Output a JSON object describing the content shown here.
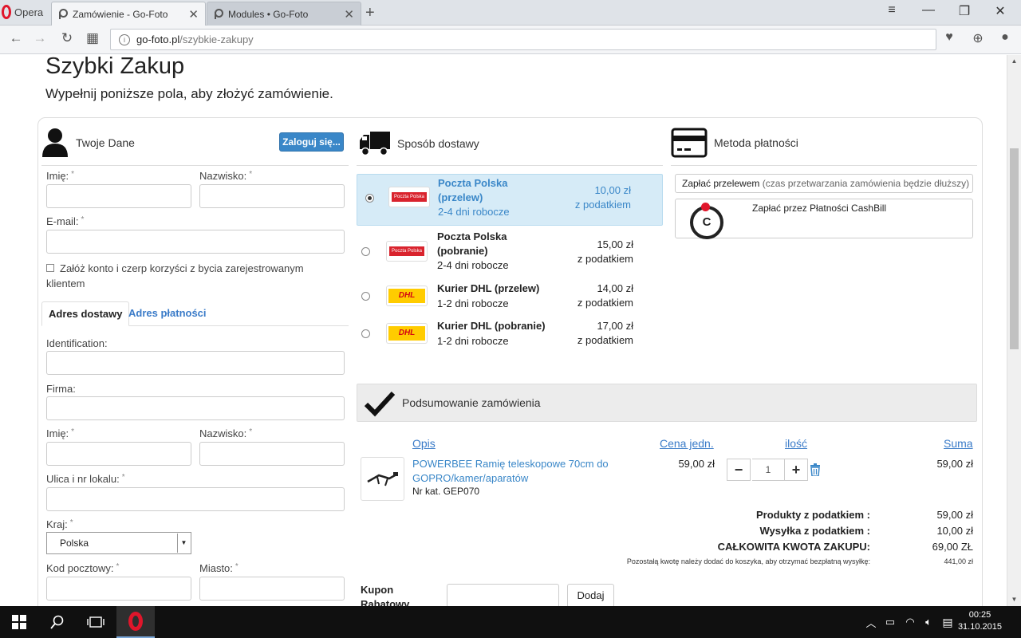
{
  "browser": {
    "menu_label": "Opera",
    "tabs": [
      {
        "title": "Zamówienie - Go-Foto"
      },
      {
        "title": "Modules • Go-Foto"
      }
    ],
    "url_host": "go-foto.pl",
    "url_path": "/szybkie-zakupy"
  },
  "page": {
    "title": "Szybki Zakup",
    "subtitle": "Wypełnij poniższe pola, aby złożyć zamówienie."
  },
  "customer": {
    "heading": "Twoje Dane",
    "login_button": "Zaloguj się...",
    "first_name_label": "Imię:",
    "last_name_label": "Nazwisko:",
    "email_label": "E-mail:",
    "create_account_label": "Załóż konto i czerp korzyści z bycia zarejestrowanym klientem",
    "required_mark": "*",
    "tabs": [
      "Adres dostawy",
      "Adres płatności"
    ],
    "identification_label": "Identification:",
    "company_label": "Firma:",
    "street_label": "Ulica i nr lokalu:",
    "country_label": "Kraj:",
    "country_value": "Polska",
    "postcode_label": "Kod pocztowy:",
    "city_label": "Miasto:"
  },
  "shipping": {
    "heading": "Sposób dostawy",
    "options": [
      {
        "name_line1": "Poczta Polska",
        "name_line2": "(przelew)",
        "days": "2-4 dni robocze",
        "price": "10,00 zł",
        "tax": "z podatkiem",
        "logo": "Poczta Polska"
      },
      {
        "name_line1": "Poczta Polska",
        "name_line2": "(pobranie)",
        "days": "2-4 dni robocze",
        "price": "15,00 zł",
        "tax": "z podatkiem",
        "logo": "Poczta Polska"
      },
      {
        "name_line1": "Kurier DHL (przelew)",
        "days": "1-2 dni robocze",
        "price": "14,00 zł",
        "tax": "z podatkiem",
        "logo": "DHL"
      },
      {
        "name_line1": "Kurier DHL (pobranie)",
        "days": "1-2 dni robocze",
        "price": "17,00 zł",
        "tax": "z podatkiem",
        "logo": "DHL"
      }
    ]
  },
  "payment": {
    "heading": "Metoda płatności",
    "transfer_label": "Zapłać przelewem",
    "transfer_note": " (czas przetwarzania zamówienia będzie dłuższy)",
    "cashbill_label": "Zapłać przez Płatności CashBill",
    "cashbill_letter": "C"
  },
  "summary": {
    "heading": "Podsumowanie zamówienia",
    "col_desc": "Opis",
    "col_unit": "Cena jedn.",
    "col_qty": "ilość",
    "col_sum": "Suma",
    "product_name": "POWERBEE Ramię teleskopowe 70cm do GOPRO/kamer/aparatów",
    "product_ref": "Nr kat. GEP070",
    "unit_price": "59,00 zł",
    "quantity": "1",
    "line_total": "59,00 zł",
    "products_label": "Produkty  z podatkiem :",
    "products_value": "59,00 zł",
    "shipping_label": "Wysyłka  z podatkiem :",
    "shipping_value": "10,00 zł",
    "total_label": "CAŁKOWITA KWOTA ZAKUPU:",
    "total_value": "69,00 ZŁ",
    "free_shipping_note": "Pozostałą kwotę należy dodać do koszyka, aby otrzymać bezpłatną wysyłkę:",
    "free_shipping_value": "441,00 zł",
    "coupon_label": "Kupon Rabatowy",
    "coupon_button": "Dodaj"
  },
  "taskbar": {
    "time": "00:25",
    "date": "31.10.2015"
  },
  "colors": {
    "accent": "#3a87c8",
    "selected_row": "#d6ebf7",
    "opera_red": "#e0162b",
    "dhl_yellow": "#ffcc00"
  }
}
